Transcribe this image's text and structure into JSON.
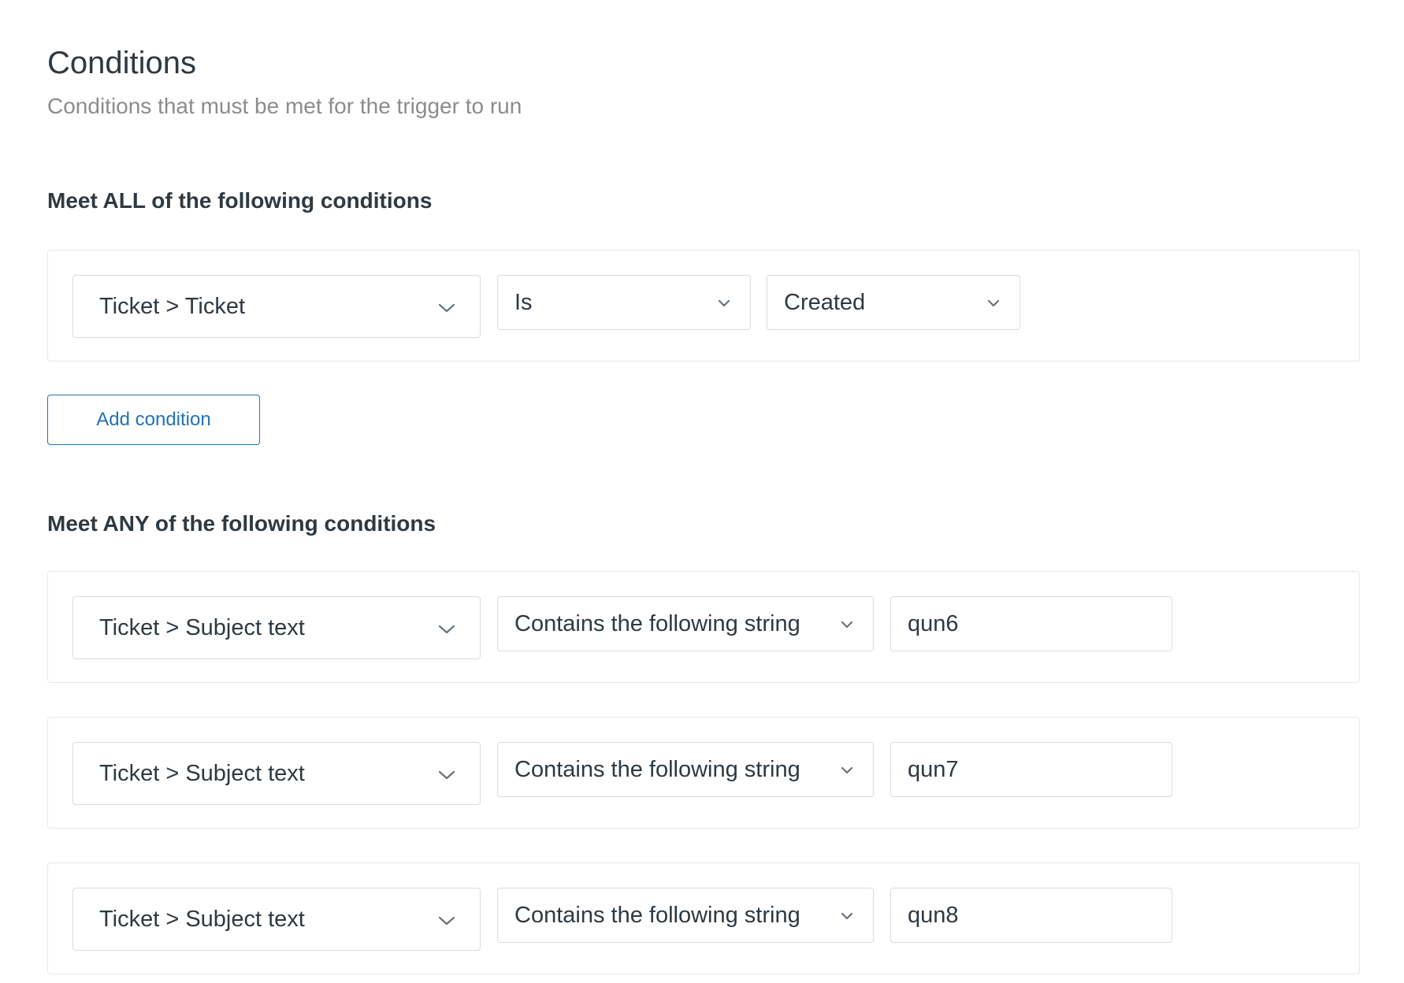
{
  "page": {
    "title": "Conditions",
    "subtitle": "Conditions that must be met for the trigger to run"
  },
  "all_group": {
    "heading": "Meet ALL of the following conditions",
    "conditions": [
      {
        "field": "Ticket > Ticket",
        "operator": "Is",
        "value": "Created"
      }
    ],
    "add_button_label": "Add condition"
  },
  "any_group": {
    "heading": "Meet ANY of the following conditions",
    "conditions": [
      {
        "field": "Ticket > Subject text",
        "operator": "Contains the following string",
        "value": "qun6"
      },
      {
        "field": "Ticket > Subject text",
        "operator": "Contains the following string",
        "value": "qun7"
      },
      {
        "field": "Ticket > Subject text",
        "operator": "Contains the following string",
        "value": "qun8"
      }
    ]
  },
  "icons": {
    "dropdown": "chevron-down-icon"
  }
}
